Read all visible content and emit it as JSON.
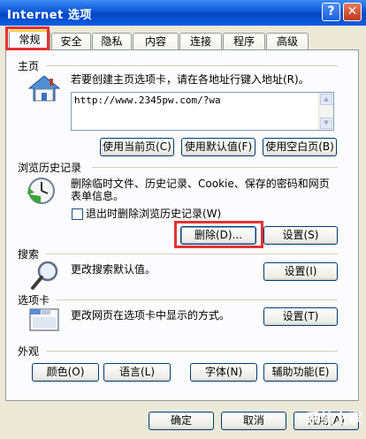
{
  "window": {
    "title": "Internet 选项",
    "help_label": "?",
    "close_label": "✕"
  },
  "tabs": [
    {
      "label": "常规"
    },
    {
      "label": "安全"
    },
    {
      "label": "隐私"
    },
    {
      "label": "内容"
    },
    {
      "label": "连接"
    },
    {
      "label": "程序"
    },
    {
      "label": "高级"
    }
  ],
  "homepage": {
    "title": "主页",
    "hint": "若要创建主页选项卡，请在各地址行键入地址(R)。",
    "url": "http://www.2345pw.com/?wa",
    "btn_current": "使用当前页(C)",
    "btn_default": "使用默认值(F)",
    "btn_blank": "使用空白页(B)"
  },
  "history": {
    "title": "浏览历史记录",
    "desc_line1": "删除临时文件、历史记录、Cookie、保存的密码和网页",
    "desc_line2": "表单信息。",
    "checkbox_label": "退出时删除浏览历史记录(W)",
    "checkbox_checked": false,
    "btn_delete": "删除(D)...",
    "btn_settings": "设置(S)"
  },
  "search": {
    "title": "搜索",
    "desc": "更改搜索默认值。",
    "btn_settings": "设置(I)"
  },
  "tabsec": {
    "title": "选项卡",
    "desc": "更改网页在选项卡中显示的方式。",
    "btn_settings": "设置(T)"
  },
  "appearance": {
    "title": "外观",
    "btn_colors": "颜色(O)",
    "btn_languages": "语言(L)",
    "btn_fonts": "字体(N)",
    "btn_accessibility": "辅助功能(E)"
  },
  "footer": {
    "ok": "确定",
    "cancel": "取消",
    "apply": "应用(A)"
  },
  "watermark": "系统之家",
  "colors": {
    "highlight": "#e53232",
    "titlebar": "#0a58d6"
  }
}
